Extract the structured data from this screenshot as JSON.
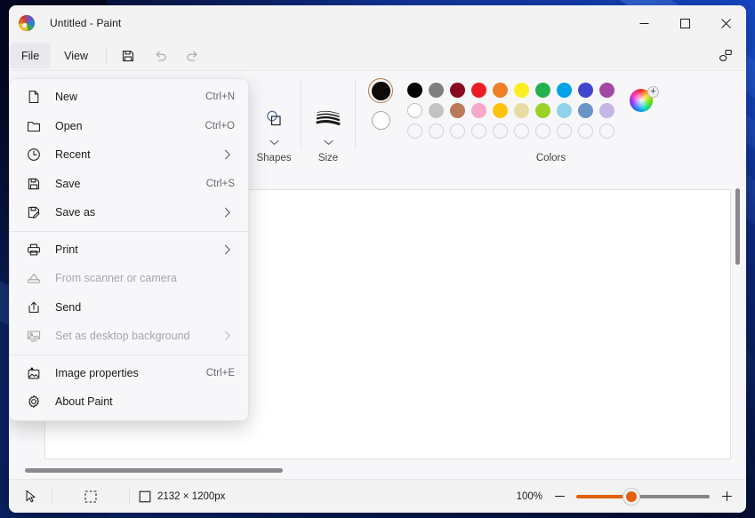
{
  "window": {
    "title": "Untitled - Paint",
    "app_icon": "paint-palette-icon",
    "controls": {
      "minimize": "Minimize",
      "maximize": "Maximize",
      "close": "Close"
    }
  },
  "commandbar": {
    "tabs": [
      {
        "label": "File",
        "active": true
      },
      {
        "label": "View",
        "active": false
      }
    ],
    "quick_actions": [
      {
        "name": "save-icon",
        "label": "Save",
        "disabled": false
      },
      {
        "name": "undo-icon",
        "label": "Undo",
        "disabled": true
      },
      {
        "name": "redo-icon",
        "label": "Redo",
        "disabled": true
      }
    ],
    "copilot": {
      "name": "copilot-icon",
      "label": "Copilot"
    }
  },
  "toolbar": {
    "groups": [
      {
        "name": "shapes",
        "label": "Shapes",
        "icon": "shapes-icon"
      },
      {
        "name": "size",
        "label": "Size",
        "icon": "brush-size-icon"
      }
    ],
    "colors": {
      "label": "Colors",
      "primary": "#0f0a08",
      "primary_selected": true,
      "secondary": "#ffffff",
      "secondary_selected": false,
      "row1": [
        "#000000",
        "#7f7f7f",
        "#870b20",
        "#ed1c24",
        "#f07e26",
        "#fcee21",
        "#22b14c",
        "#00a2e8",
        "#3f48cc",
        "#a349a4"
      ],
      "row2": [
        "#ffffff",
        "#c3c3c3",
        "#b97a57",
        "#f7a7c8",
        "#ffc20e",
        "#e7dca2",
        "#99d326",
        "#8fd3e8",
        "#6a95c8",
        "#c5b6e3"
      ],
      "row3": [
        "",
        "",
        "",
        "",
        "",
        "",
        "",
        "",
        "",
        ""
      ],
      "custom_color_button": "color-wheel-add-icon"
    }
  },
  "file_menu": {
    "items": [
      {
        "id": "new",
        "icon": "new-document-icon",
        "label": "New",
        "accel": "Ctrl+N",
        "submenu": false,
        "disabled": false
      },
      {
        "id": "open",
        "icon": "folder-open-icon",
        "label": "Open",
        "accel": "Ctrl+O",
        "submenu": false,
        "disabled": false
      },
      {
        "id": "recent",
        "icon": "clock-icon",
        "label": "Recent",
        "accel": "",
        "submenu": true,
        "disabled": false
      },
      {
        "id": "save",
        "icon": "save-floppy-icon",
        "label": "Save",
        "accel": "Ctrl+S",
        "submenu": false,
        "disabled": false
      },
      {
        "id": "save-as",
        "icon": "save-as-pencil-icon",
        "label": "Save as",
        "accel": "",
        "submenu": true,
        "disabled": false
      },
      {
        "id": "separator1",
        "icon": "",
        "label": "",
        "accel": "",
        "submenu": false,
        "disabled": false,
        "separator": true
      },
      {
        "id": "print",
        "icon": "printer-icon",
        "label": "Print",
        "accel": "",
        "submenu": true,
        "disabled": false
      },
      {
        "id": "scanner",
        "icon": "scanner-icon",
        "label": "From scanner or camera",
        "accel": "",
        "submenu": false,
        "disabled": true
      },
      {
        "id": "send",
        "icon": "share-send-icon",
        "label": "Send",
        "accel": "",
        "submenu": false,
        "disabled": false
      },
      {
        "id": "desktop-bg",
        "icon": "desktop-image-icon",
        "label": "Set as desktop background",
        "accel": "",
        "submenu": true,
        "disabled": true
      },
      {
        "id": "separator2",
        "icon": "",
        "label": "",
        "accel": "",
        "submenu": false,
        "disabled": false,
        "separator": true
      },
      {
        "id": "image-props",
        "icon": "image-properties-icon",
        "label": "Image properties",
        "accel": "Ctrl+E",
        "submenu": false,
        "disabled": false
      },
      {
        "id": "about",
        "icon": "gear-icon",
        "label": "About Paint",
        "accel": "",
        "submenu": false,
        "disabled": false
      }
    ]
  },
  "statusbar": {
    "cursor_icon": "cursor-arrow-icon",
    "selection_icon": "selection-marquee-icon",
    "image_size_icon": "image-dimensions-icon",
    "image_size": "2132 × 1200px",
    "zoom_percent": "100%",
    "zoom_out_label": "−",
    "zoom_in_label": "+"
  },
  "theme": {
    "accent": "#e2600f",
    "window_bg": "#f3f3f3",
    "canvas_bg": "#ffffff",
    "desktop_blue": "#123aa8"
  }
}
